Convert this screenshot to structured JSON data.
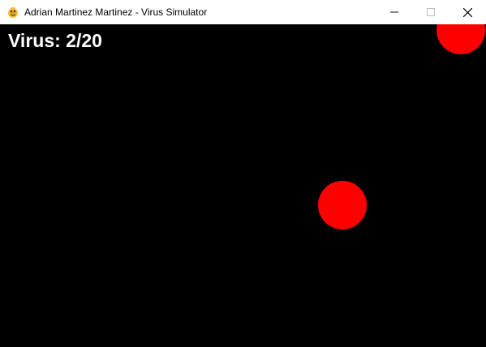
{
  "window": {
    "title": "Adrian Martinez Martinez - Virus Simulator",
    "app_icon": "pygame-snake-icon",
    "controls": [
      "minimize-icon",
      "maximize-icon",
      "close-icon"
    ]
  },
  "hud": {
    "label": "Virus: 2/20",
    "virus_count": 2,
    "virus_total": 20
  },
  "scene": {
    "background_color": "#000000",
    "virus_color": "#ff0000",
    "viruses": 2
  }
}
